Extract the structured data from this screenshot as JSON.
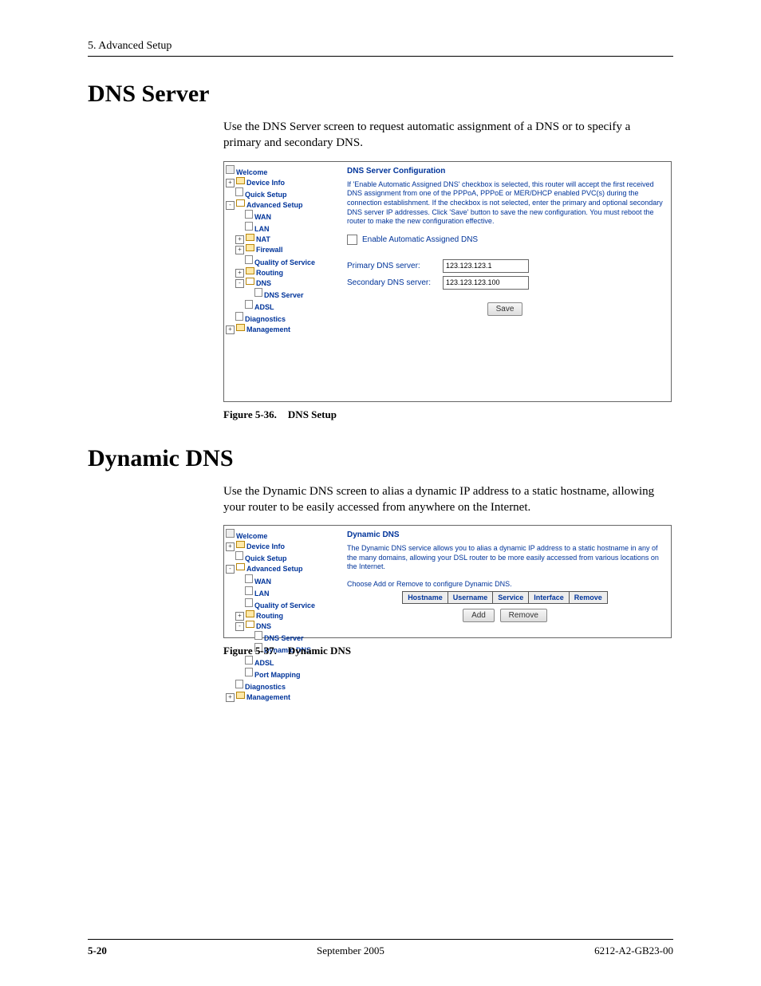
{
  "header": {
    "chapter": "5. Advanced Setup"
  },
  "section1": {
    "title": "DNS Server",
    "intro": "Use the DNS Server screen to request automatic assignment of a DNS or to specify a primary and secondary DNS.",
    "caption_label": "Figure 5-36.",
    "caption_text": "DNS Setup"
  },
  "section2": {
    "title": "Dynamic DNS",
    "intro": "Use the Dynamic DNS screen to alias a dynamic IP address to a static hostname, allowing your router to be easily accessed from anywhere on the Internet.",
    "caption_label": "Figure 5-37.",
    "caption_text": "Dynamic DNS"
  },
  "nav1": {
    "welcome": "Welcome",
    "device_info": "Device Info",
    "quick_setup": "Quick Setup",
    "advanced_setup": "Advanced Setup",
    "wan": "WAN",
    "lan": "LAN",
    "nat": "NAT",
    "firewall": "Firewall",
    "qos": "Quality of Service",
    "routing": "Routing",
    "dns": "DNS",
    "dns_server": "DNS Server",
    "adsl": "ADSL",
    "diagnostics": "Diagnostics",
    "management": "Management"
  },
  "nav2": {
    "welcome": "Welcome",
    "device_info": "Device Info",
    "quick_setup": "Quick Setup",
    "advanced_setup": "Advanced Setup",
    "wan": "WAN",
    "lan": "LAN",
    "qos": "Quality of Service",
    "routing": "Routing",
    "dns": "DNS",
    "dns_server": "DNS Server",
    "dynamic_dns": "Dynamic DNS",
    "adsl": "ADSL",
    "port_mapping": "Port Mapping",
    "diagnostics": "Diagnostics",
    "management": "Management"
  },
  "dns_panel": {
    "title": "DNS Server Configuration",
    "description": "If 'Enable Automatic Assigned DNS' checkbox is selected, this router will accept the first received DNS assignment from one of the PPPoA, PPPoE or MER/DHCP enabled PVC(s) during the connection establishment. If the checkbox is not selected, enter the primary and optional secondary DNS server IP addresses. Click 'Save' button to save the new configuration. You must reboot the router to make the new configuration effective.",
    "checkbox_label": "Enable Automatic Assigned DNS",
    "primary_label": "Primary DNS server:",
    "primary_value": "123.123.123.1",
    "secondary_label": "Secondary DNS server:",
    "secondary_value": "123.123.123.100",
    "save": "Save"
  },
  "ddns_panel": {
    "title": "Dynamic DNS",
    "description": "The Dynamic DNS service allows you to alias a dynamic IP address to a static hostname in any of the many domains, allowing your DSL router to be more easily accessed from various locations on the Internet.",
    "instruction": "Choose Add or Remove to configure Dynamic DNS.",
    "cols": {
      "hostname": "Hostname",
      "username": "Username",
      "service": "Service",
      "interface": "Interface",
      "remove": "Remove"
    },
    "add": "Add",
    "remove": "Remove"
  },
  "footer": {
    "page": "5-20",
    "date": "September 2005",
    "doc": "6212-A2-GB23-00"
  }
}
